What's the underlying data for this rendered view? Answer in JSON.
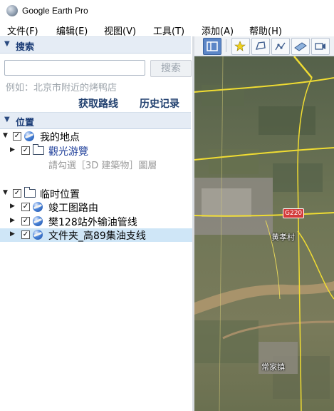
{
  "window": {
    "title": "Google Earth Pro"
  },
  "menu": [
    "文件(F)",
    "编辑(E)",
    "视图(V)",
    "工具(T)",
    "添加(A)",
    "帮助(H)"
  ],
  "search": {
    "header": "搜索",
    "button": "搜索",
    "hint": "例如：北京市附近的烤鸭店",
    "directions_link": "获取路线",
    "history_link": "历史记录"
  },
  "places": {
    "header": "位置",
    "my_places": {
      "label": "我的地点",
      "children": [
        {
          "label": "觀光游覽",
          "checked": true,
          "icon": "folder-icon"
        }
      ],
      "note": "請勾選［3D 建築物］圖層"
    },
    "temp_places": {
      "label": "临时位置",
      "children": [
        {
          "label": "竣工图路由",
          "checked": true,
          "icon": "globe-icon"
        },
        {
          "label": "樊128站外输油管线",
          "checked": true,
          "icon": "globe-icon"
        },
        {
          "label": "文件夹_高89集油支线",
          "checked": true,
          "icon": "globe-icon",
          "selected": true
        }
      ]
    }
  },
  "toolbar": {
    "buttons": [
      "sidebar-toggle-icon",
      "add-placemark-icon",
      "add-polygon-icon",
      "add-path-icon",
      "add-image-overlay-icon",
      "record-tour-icon"
    ]
  },
  "map": {
    "labels": {
      "road_shield": "G220",
      "town_1": "黄孝村",
      "town_2": "常家镇"
    }
  },
  "colors": {
    "panel_header": "#e5ecf5",
    "selection": "#cfe6f7",
    "link": "#21406f"
  }
}
